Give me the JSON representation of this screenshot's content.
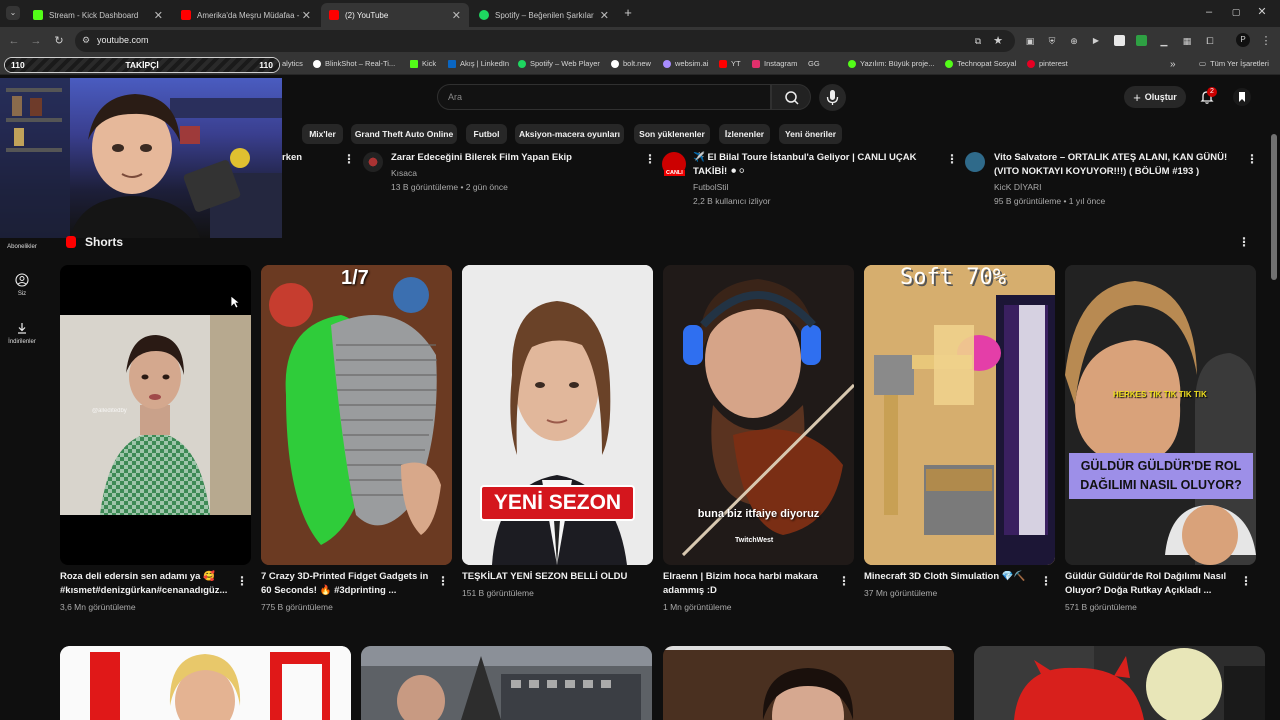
{
  "browser": {
    "tabs": [
      {
        "label": "Stream - Kick Dashboard",
        "color": "#53fc18"
      },
      {
        "label": "Amerika'da Meşru Müdafaa - Y",
        "color": "#ff0000"
      },
      {
        "label": "(2) YouTube",
        "color": "#ff0000"
      },
      {
        "label": "Spotify – Beğenilen Şarkılar",
        "color": "#1ed760"
      }
    ],
    "new_tab_icon": "plus-icon",
    "url": "youtube.com",
    "bookmarks": [
      {
        "label": "alytics",
        "color": "#888888"
      },
      {
        "label": "BlinkShot – Real-Ti...",
        "color": "#ffffff"
      },
      {
        "label": "Kick",
        "color": "#53fc18"
      },
      {
        "label": "Akış | LinkedIn",
        "color": "#0a66c2"
      },
      {
        "label": "Spotify – Web Player",
        "color": "#1ed760"
      },
      {
        "label": "bolt.new",
        "color": "#ffffff"
      },
      {
        "label": "websim.ai",
        "color": "#a88cff"
      },
      {
        "label": "YT",
        "color": "#ff0000"
      },
      {
        "label": "Instagram",
        "color": "#e1306c"
      },
      {
        "label": "GG",
        "color": "#cccccc"
      },
      {
        "label": "Yazılım: Büyük proje...",
        "color": "#53fc18"
      },
      {
        "label": "Technopat Sosyal",
        "color": "#53fc18"
      },
      {
        "label": "pinterest",
        "color": "#e60023"
      }
    ],
    "all_bookmarks": "Tüm Yer İşaretleri"
  },
  "overlay": {
    "label": "TAKİPÇİ",
    "left_count": "110",
    "right_count": "110"
  },
  "header": {
    "search_placeholder": "Ara",
    "create_label": "Oluştur",
    "notification_count": "2"
  },
  "chips": [
    "rken",
    "Mix'ler",
    "Grand Theft Auto Online",
    "Futbol",
    "Aksiyon-macera oyunları",
    "Son yüklenenler",
    "İzlenenler",
    "Yeni öneriler"
  ],
  "sidebar": {
    "subscriptions": "Abonelikler",
    "you": "Siz",
    "downloads": "İndirilenler"
  },
  "top_videos": [
    {
      "title": "rken"
    },
    {
      "title": "Zarar Edeceğini Bilerek Film Yapan Ekip",
      "channel": "Kısaca",
      "meta": "13 B görüntüleme • 2 gün önce"
    },
    {
      "title": "✈️ El Bilal Toure İstanbul'a Geliyor | CANLI UÇAK TAKİBİ! ⚫⚪",
      "channel": "FutbolStil",
      "meta": "2,2 B kullanıcı izliyor",
      "live": "CANLI"
    },
    {
      "title": "Vito Salvatore – ORTALIK ATEŞ ALANI, KAN GÜNÜ! (VITO NOKTAYI KOYUYOR!!!) ( BÖLÜM #193 )",
      "channel": "KicK DİYARI",
      "meta": "95 B görüntüleme • 1 yıl önce"
    }
  ],
  "shorts": {
    "section_title": "Shorts",
    "items": [
      {
        "title": "Roza deli edersin sen adamı ya 🥰 #kısmet#denizgürkan#cenanadıgüz...",
        "views": "3,6 Mn görüntüleme",
        "overlay": "@alleditedby"
      },
      {
        "title": "7 Crazy 3D-Printed Fidget Gadgets in 60 Seconds! 🔥 #3dprinting ...",
        "views": "775 B görüntüleme",
        "overlay": "1/7"
      },
      {
        "title": "TEŞKİLAT YENİ SEZON BELLİ OLDU",
        "views": "151 B görüntüleme",
        "overlay": "YENİ SEZON"
      },
      {
        "title": "Elraenn | Bizim hoca harbi makara adammış :D",
        "views": "1 Mn görüntüleme",
        "overlay": "buna biz itfaiye diyoruz",
        "brand": "TwitchWest"
      },
      {
        "title": "Minecraft 3D Cloth Simulation 💎⛏️",
        "views": "37 Mn görüntüleme",
        "overlay": "Soft 70%"
      },
      {
        "title": "Güldür Güldür'de Rol Dağılımı Nasıl Oluyor? Doğa Rutkay Açıkladı ...",
        "views": "571 B görüntüleme",
        "overlay": "GÜLDÜR GÜLDÜR'DE ROL DAĞILIMI NASIL OLUYOR?",
        "overlay_top": "HERKES TIK TIK TIK TIK"
      }
    ]
  }
}
